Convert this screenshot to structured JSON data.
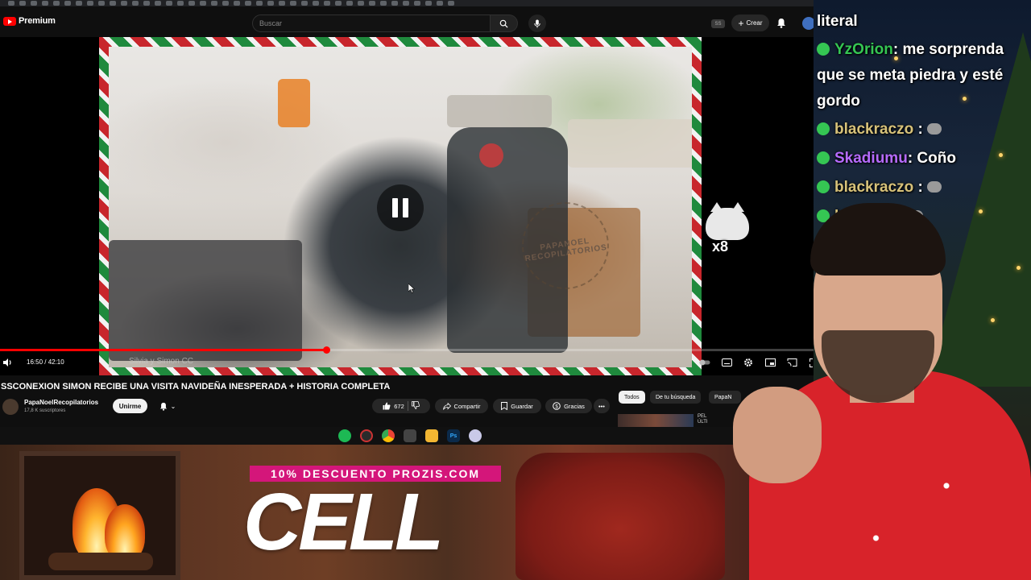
{
  "masthead": {
    "logo_text": "Premium",
    "search_placeholder": "Buscar",
    "user_badge": "SS",
    "create_label": "Crear"
  },
  "player": {
    "time": "16:50 / 42:10",
    "progress_fraction": 0.4,
    "watermark_text": "PAPANOEL RECOPILATORIOS",
    "subtitle_ghost": "Silvia y Simon CC",
    "meme_multiplier": "x8"
  },
  "video": {
    "title": "SSCONEXION SIMON RECIBE UNA VISITA NAVIDEÑA INESPERADA + HISTORIA COMPLETA",
    "channel_name": "PapaNoelRecopilatorios",
    "subscribers": "17,8 K suscriptores",
    "join_label": "Unirme",
    "like_count": "672",
    "share_label": "Compartir",
    "save_label": "Guardar",
    "thanks_label": "Gracias"
  },
  "recommendations": {
    "chips": [
      "Todos",
      "De tu búsqueda",
      "PapaN"
    ],
    "first_title": "PEL\nÚLTI"
  },
  "ad": {
    "promo": "10% DESCUENTO PROZIS.COM",
    "brand": "CELL"
  },
  "chat": {
    "messages": [
      {
        "user": "",
        "text": "literal",
        "color": "#ffffff"
      },
      {
        "user": "YzOrion",
        "text": ": me sorprenda que se meta piedra y esté gordo",
        "color": "#35c653"
      },
      {
        "user": "blackraczo",
        "text": ":",
        "color": "#d7c27a",
        "emote": true
      },
      {
        "user": "Skadiumu",
        "text": ": Coño",
        "color": "#b66bff"
      },
      {
        "user": "blackraczo",
        "text": ":",
        "color": "#d7c27a",
        "emote": true
      },
      {
        "user": "bl",
        "text": "",
        "color": "#d7c27a",
        "emote": true
      }
    ]
  },
  "colors": {
    "youtube_red": "#ff0000",
    "promo_pink": "#d4167a",
    "chat_badge_green": "#35c653"
  }
}
